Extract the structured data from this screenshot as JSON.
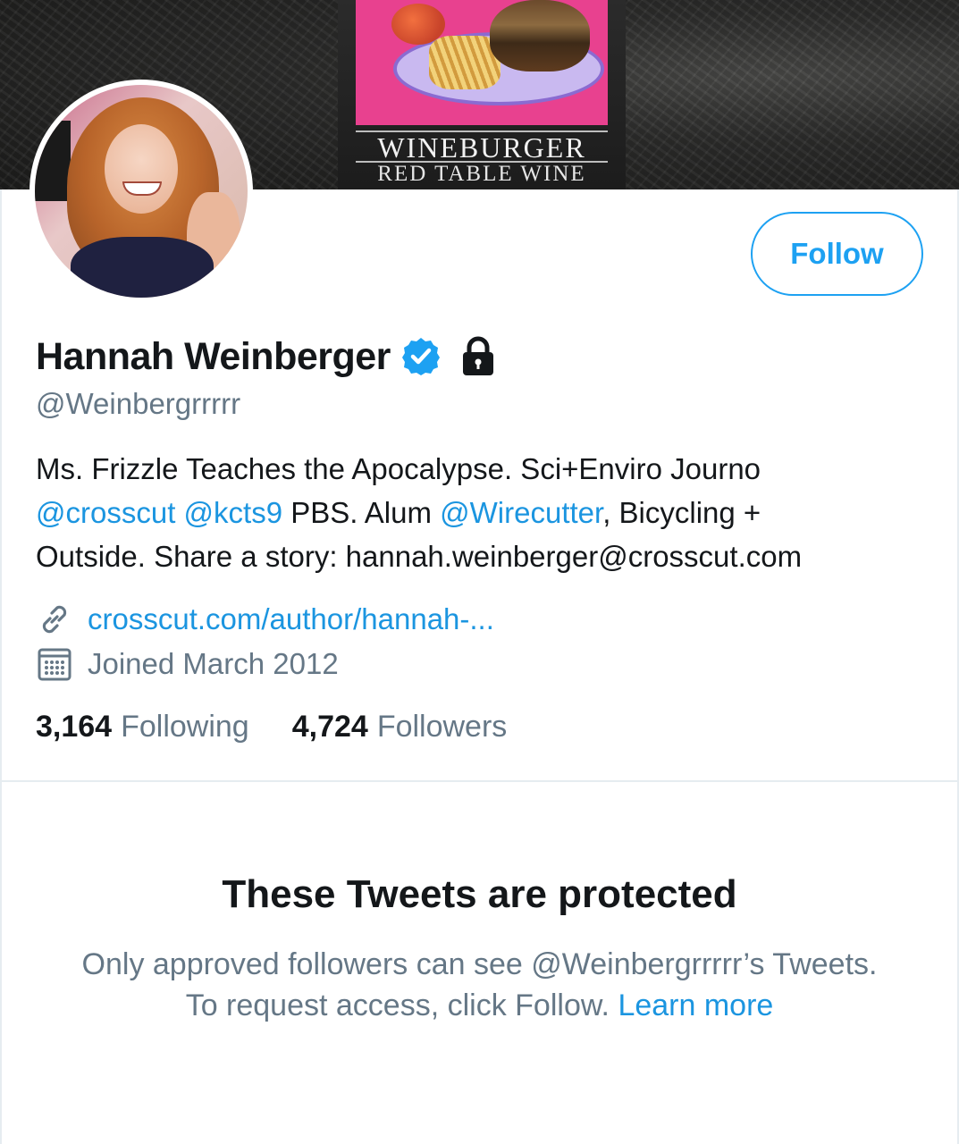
{
  "banner": {
    "label_title": "WINEBURGER",
    "label_subtitle": "RED TABLE WINE"
  },
  "profile": {
    "display_name": "Hannah Weinberger",
    "handle": "@Weinbergrrrrr",
    "follow_label": "Follow",
    "bio": {
      "line1": "Ms. Frizzle Teaches the Apocalypse. Sci+Enviro Journo",
      "mention1": "@crosscut",
      "mention2": "@kcts9",
      "text_pbs": " PBS. Alum ",
      "mention3": "@Wirecutter",
      "text_after": ", Bicycling +",
      "line3": "Outside. Share a story: hannah.weinberger@crosscut.com"
    },
    "website": "crosscut.com/author/hannah-...",
    "joined": "Joined March 2012",
    "following_count": "3,164",
    "following_label": "Following",
    "followers_count": "4,724",
    "followers_label": "Followers",
    "icons": {
      "verified": "verified-badge-icon",
      "protected": "lock-icon",
      "link": "link-icon",
      "calendar": "calendar-icon"
    }
  },
  "protected": {
    "title": "These Tweets are protected",
    "body": "Only approved followers can see @Weinbergrrrrr’s Tweets. To request access, click Follow.",
    "learn_more": "Learn more"
  },
  "colors": {
    "accent": "#1da1f2",
    "link": "#1b95e0",
    "secondary_text": "#657786",
    "primary_text": "#14171a"
  }
}
